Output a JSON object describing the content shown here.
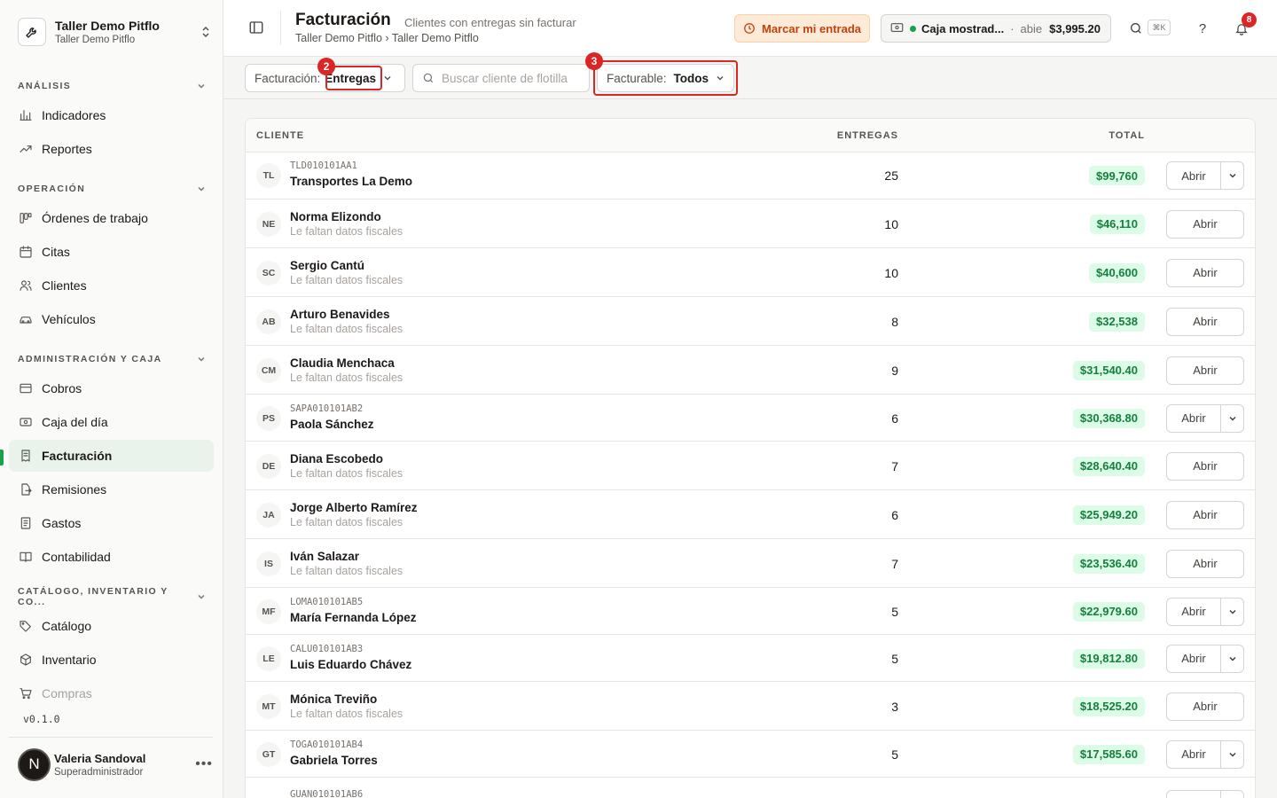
{
  "workspace": {
    "name": "Taller Demo Pitflo",
    "sub": "Taller Demo Pitflo"
  },
  "sidebar": {
    "sections": [
      {
        "title": "ANÁLISIS",
        "items": [
          {
            "label": "Indicadores",
            "icon": "bar-chart-icon"
          },
          {
            "label": "Reportes",
            "icon": "trend-icon"
          }
        ]
      },
      {
        "title": "OPERACIÓN",
        "items": [
          {
            "label": "Órdenes de trabajo",
            "icon": "kanban-icon"
          },
          {
            "label": "Citas",
            "icon": "calendar-icon"
          },
          {
            "label": "Clientes",
            "icon": "users-icon"
          },
          {
            "label": "Vehículos",
            "icon": "car-icon"
          }
        ]
      },
      {
        "title": "ADMINISTRACIÓN Y CAJA",
        "items": [
          {
            "label": "Cobros",
            "icon": "credit-card-icon"
          },
          {
            "label": "Caja del día",
            "icon": "cash-icon"
          },
          {
            "label": "Facturación",
            "icon": "invoice-icon",
            "active": true
          },
          {
            "label": "Remisiones",
            "icon": "file-export-icon"
          },
          {
            "label": "Gastos",
            "icon": "receipt-icon"
          },
          {
            "label": "Contabilidad",
            "icon": "book-icon"
          }
        ]
      },
      {
        "title": "CATÁLOGO, INVENTARIO Y CO...",
        "items": [
          {
            "label": "Catálogo",
            "icon": "tags-icon"
          },
          {
            "label": "Inventario",
            "icon": "box-icon"
          },
          {
            "label": "Compras",
            "icon": "cart-icon"
          }
        ]
      }
    ],
    "version": "v0.1.0",
    "user": {
      "initial": "N",
      "name": "Valeria Sandoval",
      "role": "Superadministrador",
      "menu": "•••"
    }
  },
  "header": {
    "title": "Facturación",
    "subtitle": "Clientes con entregas sin facturar",
    "breadcrumb": "Taller Demo Pitflo › Taller Demo Pitflo",
    "entry_button": "Marcar mi entrada",
    "caja": {
      "name": "Caja mostrad...",
      "sep": "·",
      "state": "abie",
      "amount": "$3,995.20"
    },
    "shortcut": "⌘K",
    "help": "?",
    "notifications": "8"
  },
  "toolbar": {
    "billing_label": "Facturación:",
    "billing_value": "Entregas",
    "search_placeholder": "Buscar cliente de flotilla",
    "billable_label": "Facturable:",
    "billable_value": "Todos",
    "markers": [
      "2",
      "3"
    ]
  },
  "table": {
    "headers": {
      "client": "CLIENTE",
      "deliveries": "ENTREGAS",
      "total": "TOTAL"
    },
    "open_label": "Abrir",
    "rows": [
      {
        "initials": "TL",
        "rfc": "TLD010101AA1",
        "name": "Transportes La Demo",
        "note": "",
        "deliveries": "25",
        "total": "$99,760",
        "split": true
      },
      {
        "initials": "NE",
        "rfc": "",
        "name": "Norma Elizondo",
        "note": "Le faltan datos fiscales",
        "deliveries": "10",
        "total": "$46,110",
        "split": false
      },
      {
        "initials": "SC",
        "rfc": "",
        "name": "Sergio Cantú",
        "note": "Le faltan datos fiscales",
        "deliveries": "10",
        "total": "$40,600",
        "split": false
      },
      {
        "initials": "AB",
        "rfc": "",
        "name": "Arturo Benavides",
        "note": "Le faltan datos fiscales",
        "deliveries": "8",
        "total": "$32,538",
        "split": false
      },
      {
        "initials": "CM",
        "rfc": "",
        "name": "Claudia Menchaca",
        "note": "Le faltan datos fiscales",
        "deliveries": "9",
        "total": "$31,540.40",
        "split": false
      },
      {
        "initials": "PS",
        "rfc": "SAPA010101AB2",
        "name": "Paola Sánchez",
        "note": "",
        "deliveries": "6",
        "total": "$30,368.80",
        "split": true
      },
      {
        "initials": "DE",
        "rfc": "",
        "name": "Diana Escobedo",
        "note": "Le faltan datos fiscales",
        "deliveries": "7",
        "total": "$28,640.40",
        "split": false
      },
      {
        "initials": "JA",
        "rfc": "",
        "name": "Jorge Alberto Ramírez",
        "note": "Le faltan datos fiscales",
        "deliveries": "6",
        "total": "$25,949.20",
        "split": false
      },
      {
        "initials": "IS",
        "rfc": "",
        "name": "Iván Salazar",
        "note": "Le faltan datos fiscales",
        "deliveries": "7",
        "total": "$23,536.40",
        "split": false
      },
      {
        "initials": "MF",
        "rfc": "LOMA010101AB5",
        "name": "María Fernanda López",
        "note": "",
        "deliveries": "5",
        "total": "$22,979.60",
        "split": true
      },
      {
        "initials": "LE",
        "rfc": "CALU010101AB3",
        "name": "Luis Eduardo Chávez",
        "note": "",
        "deliveries": "5",
        "total": "$19,812.80",
        "split": true
      },
      {
        "initials": "MT",
        "rfc": "",
        "name": "Mónica Treviño",
        "note": "Le faltan datos fiscales",
        "deliveries": "3",
        "total": "$18,525.20",
        "split": false
      },
      {
        "initials": "GT",
        "rfc": "TOGA010101AB4",
        "name": "Gabriela Torres",
        "note": "",
        "deliveries": "5",
        "total": "$17,585.60",
        "split": true
      },
      {
        "initials": "",
        "rfc": "GUAN010101AB6",
        "name": "",
        "note": "",
        "deliveries": "",
        "total": "",
        "split": true
      }
    ]
  }
}
